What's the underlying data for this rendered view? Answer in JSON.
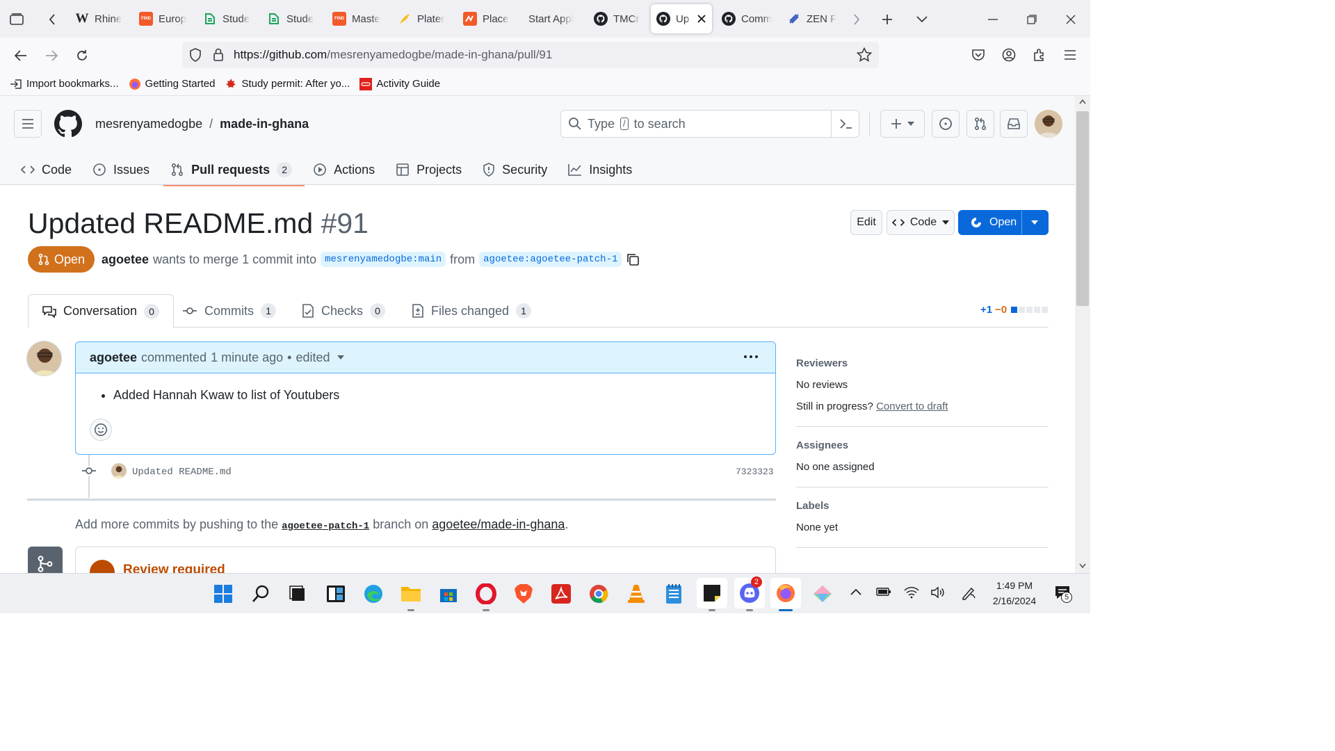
{
  "browser": {
    "tabs": [
      {
        "label": "Rhine",
        "favicon": "wikipedia-icon"
      },
      {
        "label": "Europ",
        "favicon": "findo-icon"
      },
      {
        "label": "Stude",
        "favicon": "doc-icon"
      },
      {
        "label": "Stude",
        "favicon": "doc-icon"
      },
      {
        "label": "Maste",
        "favicon": "findo-icon"
      },
      {
        "label": "Plater",
        "favicon": "feather-icon"
      },
      {
        "label": "Place",
        "favicon": "placement-icon"
      },
      {
        "label": "Start Appl",
        "favicon": ""
      },
      {
        "label": "TMCr",
        "favicon": "github-icon"
      },
      {
        "label": "Up",
        "favicon": "github-icon",
        "active": true
      },
      {
        "label": "Comm",
        "favicon": "github-icon"
      },
      {
        "label": "ZEN F",
        "favicon": "zen-icon"
      }
    ],
    "url_host": "https://github.com",
    "url_path": "/mesrenyamedogbe/made-in-ghana/pull/91",
    "bookmarks": [
      {
        "label": "Import bookmarks...",
        "icon": "import-icon"
      },
      {
        "label": "Getting Started",
        "icon": "firefox-icon"
      },
      {
        "label": "Study permit: After yo...",
        "icon": "maple-leaf-icon"
      },
      {
        "label": "Activity Guide",
        "icon": "oracle-icon"
      }
    ]
  },
  "header": {
    "owner": "mesrenyamedogbe",
    "separator": "/",
    "repo": "made-in-ghana",
    "search_pre": "Type",
    "search_key": "/",
    "search_post": "to search"
  },
  "repo_tabs": [
    {
      "label": "Code",
      "icon": "code-icon"
    },
    {
      "label": "Issues",
      "icon": "issue-icon"
    },
    {
      "label": "Pull requests",
      "icon": "pull-request-icon",
      "count": "2",
      "selected": true
    },
    {
      "label": "Actions",
      "icon": "play-icon"
    },
    {
      "label": "Projects",
      "icon": "table-icon"
    },
    {
      "label": "Security",
      "icon": "shield-icon"
    },
    {
      "label": "Insights",
      "icon": "graph-icon"
    }
  ],
  "pr": {
    "title": "Updated README.md",
    "number": "#91",
    "edit_label": "Edit",
    "code_label": "Code",
    "open_button_label": "Open",
    "state": "Open",
    "author": "agoetee",
    "merge_text": "wants to merge 1 commit into",
    "base_branch": "mesrenyamedogbe:main",
    "from_text": "from",
    "head_branch": "agoetee:agoetee-patch-1",
    "diff_add": "+1",
    "diff_del": "−0"
  },
  "pr_tabs": [
    {
      "label": "Conversation",
      "count": "0"
    },
    {
      "label": "Commits",
      "count": "1"
    },
    {
      "label": "Checks",
      "count": "0"
    },
    {
      "label": "Files changed",
      "count": "1"
    }
  ],
  "comment": {
    "author": "agoetee",
    "action": "commented",
    "time": "1 minute ago",
    "dot": "•",
    "edited": "edited",
    "bullet": "Added Hannah Kwaw to list of Youtubers"
  },
  "commit": {
    "message": "Updated README.md",
    "sha": "7323323"
  },
  "push_hint": {
    "pre": "Add more commits by pushing to the",
    "branch": "agoetee-patch-1",
    "mid": "branch on",
    "repo": "agoetee/made-in-ghana",
    "post": "."
  },
  "review": {
    "label": "Review required"
  },
  "sidebar": {
    "reviewers_title": "Reviewers",
    "reviewers_value": "No reviews",
    "draft_q": "Still in progress?",
    "draft_link": "Convert to draft",
    "assignees_title": "Assignees",
    "assignees_value": "No one assigned",
    "labels_title": "Labels",
    "labels_value": "None yet"
  },
  "taskbar": {
    "time": "1:49 PM",
    "date": "2/16/2024",
    "discord_badge": "2",
    "notification_count": "5"
  },
  "colors": {
    "accent_blue": "#0969da",
    "open_orange": "#d1711c",
    "tab_underline": "#fd8c73"
  }
}
